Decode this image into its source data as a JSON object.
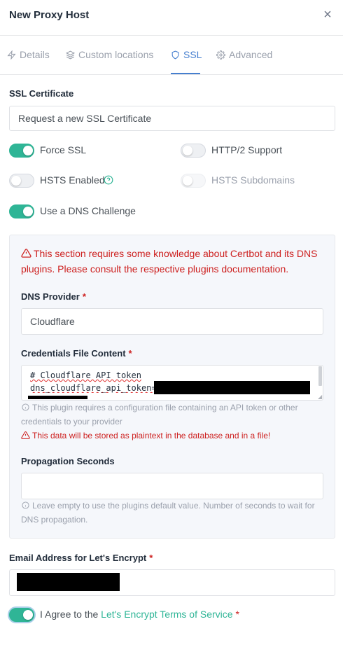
{
  "modal": {
    "title": "New Proxy Host",
    "close_glyph": "×"
  },
  "tabs": [
    {
      "label": "Details",
      "icon": "zap-icon",
      "active": false
    },
    {
      "label": "Custom locations",
      "icon": "layers-icon",
      "active": false
    },
    {
      "label": "SSL",
      "icon": "shield-icon",
      "active": true
    },
    {
      "label": "Advanced",
      "icon": "gear-icon",
      "active": false
    }
  ],
  "ssl": {
    "certificate_label": "SSL Certificate",
    "certificate_value": "Request a new SSL Certificate",
    "force_ssl": {
      "label": "Force SSL",
      "on": true
    },
    "http2": {
      "label": "HTTP/2 Support",
      "on": false
    },
    "hsts": {
      "label": "HSTS Enabled",
      "on": false
    },
    "hsts_sub": {
      "label": "HSTS Subdomains",
      "on": false,
      "disabled": true
    },
    "dns_challenge": {
      "label": "Use a DNS Challenge",
      "on": true
    }
  },
  "dns": {
    "warning": "This section requires some knowledge about Certbot and its DNS plugins. Please consult the respective plugins documentation.",
    "provider_label": "DNS Provider",
    "provider_value": "Cloudflare",
    "credentials_label": "Credentials File Content",
    "credentials_line1": "# Cloudflare API token",
    "credentials_line2_prefix": "dns_cloudflare_api_token=",
    "credentials_help": "This plugin requires a configuration file containing an API token or other credentials to your provider",
    "credentials_warning": "This data will be stored as plaintext in the database and in a file!",
    "propagation_label": "Propagation Seconds",
    "propagation_value": "",
    "propagation_help": "Leave empty to use the plugins default value. Number of seconds to wait for DNS propagation."
  },
  "email": {
    "label": "Email Address for Let's Encrypt"
  },
  "agree": {
    "prefix": "I Agree to the ",
    "link": "Let's Encrypt Terms of Service",
    "on": true
  },
  "required_mark": "*",
  "colors": {
    "accent": "#467fcf",
    "toggle_on": "#2fb596",
    "danger": "#cd201f"
  }
}
